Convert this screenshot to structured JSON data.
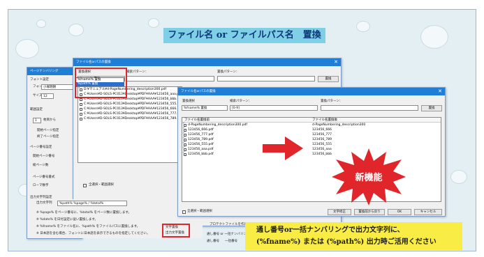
{
  "banner": {
    "title": "ファイル名 or ファイルパス名　置換"
  },
  "page_window": {
    "title": "ページナンバリング",
    "font_setting": "フォント設定",
    "font_label": "フォント",
    "font_value": "小塚明朝",
    "size_label": "サイズ",
    "size_value": "12",
    "range_setting": "範囲設定",
    "start_value": "1",
    "start_label": "枚目から",
    "opt_start": "開始ページ指定",
    "opt_end": "終了ページ指定",
    "page_number_setting": "ページ番号設定",
    "start_page_number": "開始ページ番号",
    "total_pages": "総ページ数",
    "page_number_format": "ページ番号書式",
    "roman_note": "ローマ数字",
    "output_string_setting": "出力文字列設定",
    "output_string_label": "出力文字列",
    "output_string_value": "%path% %page% / %total%",
    "note1": "※ %page% をページ番号に、%total% をページ数に置換します。",
    "note2": "※ %date% を日付設定に従い置換します。",
    "note3": "※ %fname% をファイル名に、%path% をファイルパスに置換します。",
    "note4": "※ 日本語を含む場合、フォントに日本語を表示できるものを指定してください。",
    "opt_string_replace": "文字置換",
    "opt_output_string_replace": "出力文字置換",
    "protect_label": "プロテクトファイルを作成する",
    "serial_label": "通し番号 or 一括ナンバリング",
    "serial_opt1": "通し番号",
    "serial_opt2": "一括番号"
  },
  "mid_dialog": {
    "title": "ファイル名orパスの置換",
    "replace_select": "置換選択",
    "search_pattern": "検索パターン：",
    "replace_pattern": "置換パターン：",
    "combo_value": "%path% 置換",
    "dropdown_options": [
      "%fname% 置換",
      "%path% 置換"
    ],
    "replace_button": "置換",
    "files": [
      "D:¥マニュアル¥d-PageNumbering_description300.pdf",
      "C:¥Users¥D-SOLS-PC013¥Desktop¥PDF¥AAA¥123456_aaa.pdf",
      "C:¥Users¥D-SOLS-PC013¥Desktop¥PDF¥AAA¥123456_bbb.pdf",
      "C:¥Users¥D-SOLS-PC013¥Desktop¥PDF¥AAA¥123456_555.pdf",
      "C:¥Users¥D-SOLS-PC013¥Desktop¥PDF¥AAA¥123456_666.pdf",
      "C:¥Users¥D-SOLS-PC013¥Desktop¥PDF¥AAA¥123456_777.pdf",
      "C:¥Users¥D-SOLS-PC013¥Desktop¥PDF¥AAA¥123456_789.pdf"
    ],
    "select_all": "全選択・範囲選択"
  },
  "front_dialog": {
    "title": "ファイル名orパスの置換",
    "replace_select": "置換選択",
    "search_pattern": "検索パターン：",
    "replace_pattern": "置換パターン：",
    "combo_value": "%fname% 置換",
    "search_value": "[0-9]",
    "replace_button": "置換",
    "col_before": "ファイル名置換前",
    "col_after": "ファイル名置換後",
    "rows": [
      {
        "before": "d-PageNumbering_description300.pdf",
        "after": "d-PageNumbering_description300"
      },
      {
        "before": "123456_666.pdf",
        "after": "123456_666"
      },
      {
        "before": "123456_777.pdf",
        "after": "123456_777"
      },
      {
        "before": "123456_789.pdf",
        "after": "123456_789"
      },
      {
        "before": "123456_555.pdf",
        "after": "123456_555"
      },
      {
        "before": "123456_aaa.pdf",
        "after": "123456_aaa"
      },
      {
        "before": "123456_bbb.pdf",
        "after": "123456_bbb"
      }
    ],
    "select_all": "全選択・範囲選択",
    "btn_fix": "文字修正",
    "btn_restore": "置換前から戻り",
    "btn_ok": "OK",
    "btn_cancel": "キャンセル"
  },
  "new_feature": "新機能",
  "callout": {
    "line1": "通し番号or一括ナンバリングで出力文字列に、",
    "line2": "(%fname%) または (%path%) 出力時ご活用ください"
  },
  "colors": {
    "accent_red": "#e0262a",
    "title_bar": "#1f7fd6",
    "banner": "#7fd0e6",
    "note_bg": "#f9ec45"
  }
}
